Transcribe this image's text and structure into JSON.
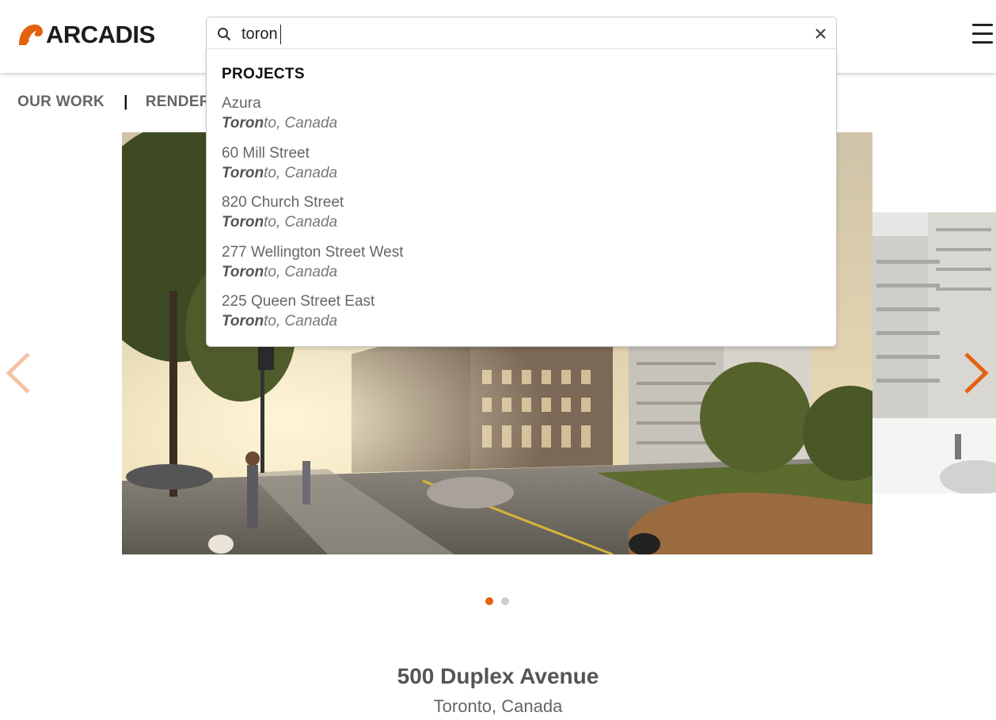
{
  "brand": {
    "name": "ARCADIS",
    "accent_color": "#e4610f"
  },
  "search": {
    "value": "toron",
    "placeholder": "",
    "icon": "search-icon",
    "clear_icon": "close-icon"
  },
  "dropdown": {
    "heading": "PROJECTS",
    "results": [
      {
        "name": "Azura",
        "loc_match": "Toron",
        "loc_rest": "to, Canada"
      },
      {
        "name": "60 Mill Street",
        "loc_match": "Toron",
        "loc_rest": "to, Canada"
      },
      {
        "name": "820 Church Street",
        "loc_match": "Toron",
        "loc_rest": "to, Canada"
      },
      {
        "name": "277 Wellington Street West",
        "loc_match": "Toron",
        "loc_rest": "to, Canada"
      },
      {
        "name": "225 Queen Street East",
        "loc_match": "Toron",
        "loc_rest": "to, Canada"
      }
    ]
  },
  "nav": {
    "our_work": "OUR WORK",
    "separator": "|",
    "renderings": "RENDERINGS"
  },
  "menu": {
    "icon": "hamburger-menu-icon"
  },
  "carousel": {
    "prev_icon": "chevron-left-icon",
    "next_icon": "chevron-right-icon",
    "slide_count": 2,
    "active_index": 0
  },
  "project": {
    "title": "500 Duplex Avenue",
    "location": "Toronto, Canada"
  }
}
